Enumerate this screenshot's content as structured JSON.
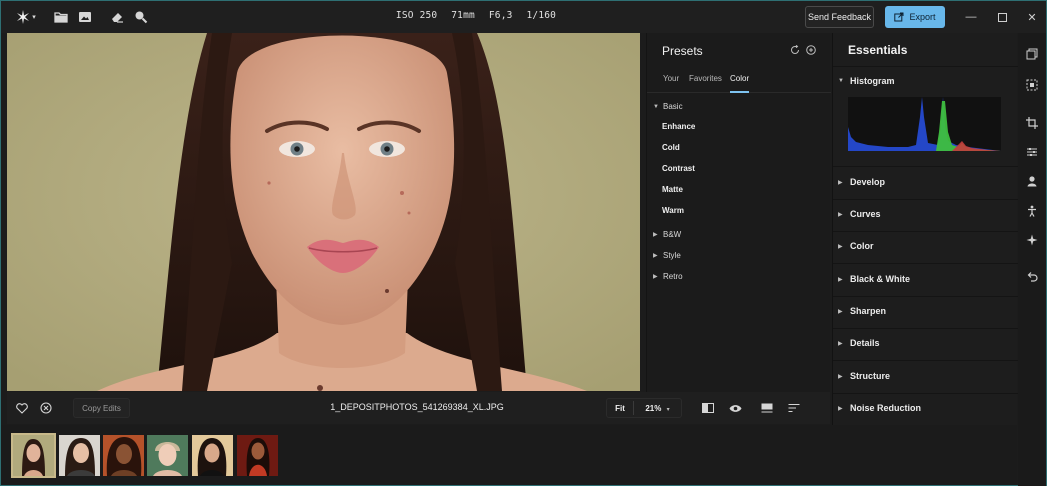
{
  "titlebar": {
    "meta": {
      "iso": "ISO 250",
      "focal": "71mm",
      "aperture": "F6,3",
      "shutter": "1/160"
    },
    "feedback_label": "Send Feedback",
    "export_label": "Export",
    "icons": [
      "app-logo-icon",
      "folder-icon",
      "image-import-icon",
      "eraser-icon",
      "search-icon"
    ]
  },
  "presets": {
    "title": "Presets",
    "tabs": [
      "Your",
      "Favorites",
      "Color"
    ],
    "active_tab": "Color",
    "groups": {
      "basic": "Basic",
      "bw": "B&W",
      "style": "Style",
      "retro": "Retro"
    },
    "basic_items": [
      "Enhance",
      "Cold",
      "Contrast",
      "Matte",
      "Warm"
    ]
  },
  "essentials": {
    "title": "Essentials",
    "sections": [
      "Histogram",
      "Develop",
      "Curves",
      "Color",
      "Black & White",
      "Sharpen",
      "Details",
      "Structure",
      "Noise Reduction"
    ]
  },
  "bottombar": {
    "copy_edits": "Copy Edits",
    "filename": "1_DEPOSITPHOTOS_541269384_XL.JPG",
    "zoom_fit": "Fit",
    "zoom_value": "21%"
  },
  "colors": {
    "accent": "#68b7ea",
    "background": "#1c1c1c",
    "photo_backdrop": "#b1aa7d"
  }
}
